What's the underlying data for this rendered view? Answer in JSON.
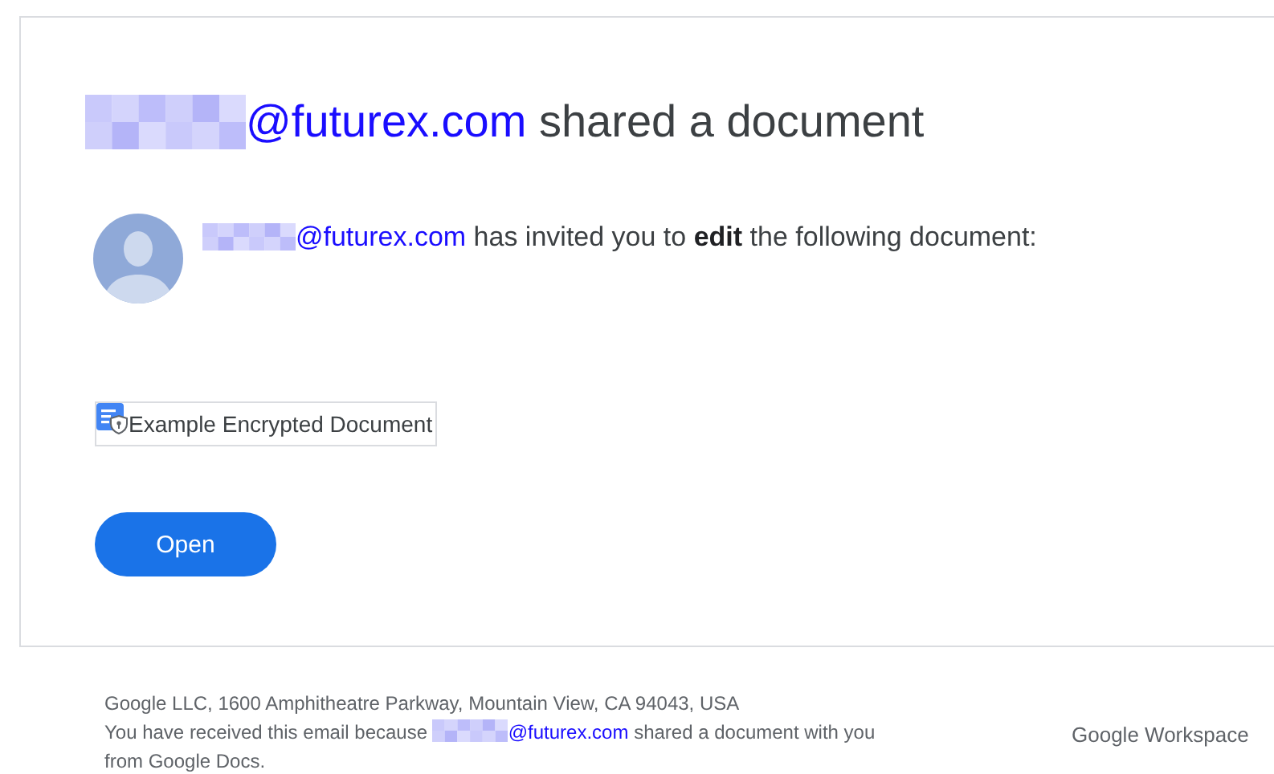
{
  "heading": {
    "sender": "@futurex.com",
    "text": "shared a document"
  },
  "invite": {
    "sender": "@futurex.com",
    "text": "has invited you to **edit** the following document:"
  },
  "document": {
    "title": "Example Encrypted Document"
  },
  "button": {
    "label": "Open"
  },
  "footer": {
    "address": "Google LLC, 1600 Amphitheatre Parkway, Mountain View, CA 94043, USA",
    "notice_before": "You have received this email because",
    "sender": "@futurex.com",
    "notice_after": "shared a document with you",
    "notice_end": "from Google Docs."
  },
  "brand": {
    "label": "Google Workspace"
  }
}
